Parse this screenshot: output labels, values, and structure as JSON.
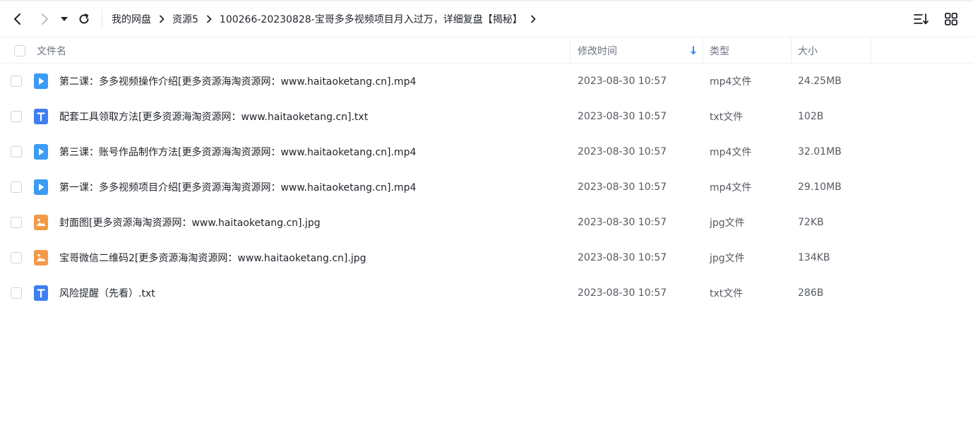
{
  "breadcrumb": [
    {
      "label": "我的网盘"
    },
    {
      "label": "资源5"
    },
    {
      "label": "100266-20230828-宝哥多多视频项目月入过万，详细复盘【揭秘】"
    }
  ],
  "table": {
    "headers": {
      "name": "文件名",
      "modified": "修改时间",
      "type": "类型",
      "size": "大小"
    },
    "rows": [
      {
        "icon": "video-file-icon",
        "name": "第二课：多多视频操作介绍[更多资源海淘资源网：www.haitaoketang.cn].mp4",
        "modified": "2023-08-30 10:57",
        "type": "mp4文件",
        "size": "24.25MB"
      },
      {
        "icon": "text-file-icon",
        "name": "配套工具领取方法[更多资源海淘资源网：www.haitaoketang.cn].txt",
        "modified": "2023-08-30 10:57",
        "type": "txt文件",
        "size": "102B"
      },
      {
        "icon": "video-file-icon",
        "name": "第三课：账号作品制作方法[更多资源海淘资源网：www.haitaoketang.cn].mp4",
        "modified": "2023-08-30 10:57",
        "type": "mp4文件",
        "size": "32.01MB"
      },
      {
        "icon": "video-file-icon",
        "name": "第一课：多多视频项目介绍[更多资源海淘资源网：www.haitaoketang.cn].mp4",
        "modified": "2023-08-30 10:57",
        "type": "mp4文件",
        "size": "29.10MB"
      },
      {
        "icon": "image-file-icon",
        "name": "封面图[更多资源海淘资源网：www.haitaoketang.cn].jpg",
        "modified": "2023-08-30 10:57",
        "type": "jpg文件",
        "size": "72KB"
      },
      {
        "icon": "image-file-icon",
        "name": "宝哥微信二维码2[更多资源海淘资源网：www.haitaoketang.cn].jpg",
        "modified": "2023-08-30 10:57",
        "type": "jpg文件",
        "size": "134KB"
      },
      {
        "icon": "text-file-icon",
        "name": "风险提醒（先看）.txt",
        "modified": "2023-08-30 10:57",
        "type": "txt文件",
        "size": "286B"
      }
    ]
  },
  "colors": {
    "video": "#3b9bf5",
    "text": "#3d7ff3",
    "image": "#f39a48",
    "sort_arrow": "#2f8cf5"
  }
}
